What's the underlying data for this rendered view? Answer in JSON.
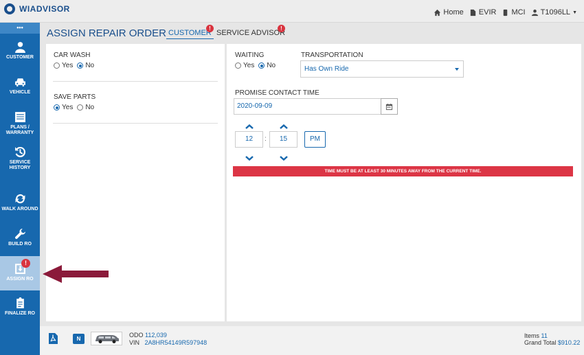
{
  "header": {
    "brand": "WIADVISOR",
    "links": {
      "home": "Home",
      "evir": "EVIR",
      "mci": "MCI",
      "user": "T1096LL"
    }
  },
  "sidebar": {
    "menu_label": "•••",
    "items": [
      {
        "label": "CUSTOMER"
      },
      {
        "label": "VEHICLE"
      },
      {
        "label": "PLANS / WARRANTY"
      },
      {
        "label": "SERVICE HISTORY"
      },
      {
        "label": "WALK AROUND"
      },
      {
        "label": "BUILD RO"
      },
      {
        "label": "ASSIGN RO",
        "badge": "!"
      },
      {
        "label": "FINALIZE RO"
      }
    ]
  },
  "page": {
    "title": "ASSIGN REPAIR ORDER",
    "tabs": [
      {
        "label": "CUSTOMER",
        "badge": "!"
      },
      {
        "label": "SERVICE ADVISOR",
        "badge": "!"
      }
    ]
  },
  "form": {
    "car_wash": {
      "label": "CAR WASH",
      "yes": "Yes",
      "no": "No",
      "selected": "No"
    },
    "save_parts": {
      "label": "SAVE PARTS",
      "yes": "Yes",
      "no": "No",
      "selected": "Yes"
    },
    "waiting": {
      "label": "WAITING",
      "yes": "Yes",
      "no": "No",
      "selected": "No"
    },
    "transportation": {
      "label": "TRANSPORTATION",
      "value": "Has Own Ride"
    },
    "promise_contact_time": {
      "label": "PROMISE CONTACT TIME",
      "date": "2020-09-09",
      "hour": "12",
      "minute": "15",
      "ampm": "PM"
    },
    "error": "TIME MUST BE AT LEAST 30 MINUTES AWAY FROM THE CURRENT TIME."
  },
  "footer": {
    "n_badge": "N",
    "odo_label": "ODO",
    "odo_value": "112,039",
    "vin_label": "VIN",
    "vin_value": "2A8HR54149R597948",
    "items_label": "Items",
    "items_value": "11",
    "total_label": "Grand Total",
    "total_value": "$910.22"
  },
  "colors": {
    "primary": "#1768ae",
    "error": "#dc3545",
    "arrow": "#8b1a3a"
  }
}
